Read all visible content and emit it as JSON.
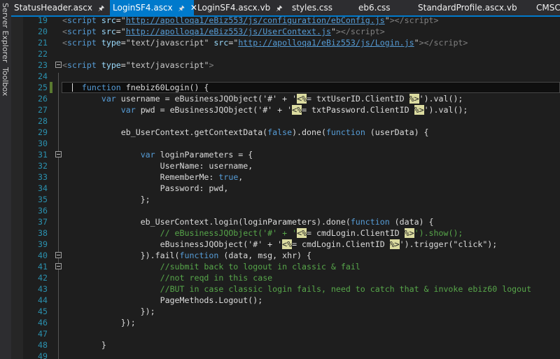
{
  "side_panels": [
    "Server Explorer",
    "Toolbox"
  ],
  "tabs": [
    {
      "label": "StatusHeader.ascx",
      "pinned": true,
      "active": false
    },
    {
      "label": "LoginSF4.ascx",
      "pinned": true,
      "active": true,
      "closable": true
    },
    {
      "label": "LoginSF4.ascx.vb",
      "pinned": true,
      "active": false
    },
    {
      "label": "styles.css",
      "active": false
    },
    {
      "label": "eb6.css",
      "active": false
    },
    {
      "label": "StandardProfile.ascx.vb",
      "active": false
    },
    {
      "label": "CMSC",
      "active": false
    }
  ],
  "icons": {
    "pin": "pin-icon",
    "close": "close-icon",
    "fold": "collapse-icon"
  },
  "editor": {
    "current_line": 25,
    "changed_lines": [
      25
    ],
    "fold_lines": [
      23,
      31,
      40,
      41
    ],
    "lines": [
      {
        "n": 19,
        "t": [
          [
            "<",
            "g"
          ],
          [
            "script",
            "k"
          ],
          [
            " src",
            "a"
          ],
          [
            "=",
            "p"
          ],
          [
            "\"",
            "s"
          ],
          [
            "http://apolloqa1/eBiz553/js/configuration/ebConfig.js",
            "u"
          ],
          [
            "\"",
            "s"
          ],
          [
            "></script>",
            "g"
          ]
        ]
      },
      {
        "n": 20,
        "t": [
          [
            "<",
            "g"
          ],
          [
            "script",
            "k"
          ],
          [
            " src",
            "a"
          ],
          [
            "=",
            "p"
          ],
          [
            "\"",
            "s"
          ],
          [
            "http://apolloqa1/eBiz553/js/UserContext.js",
            "u"
          ],
          [
            "\"",
            "s"
          ],
          [
            "></script>",
            "g"
          ]
        ]
      },
      {
        "n": 21,
        "t": [
          [
            "<",
            "g"
          ],
          [
            "script",
            "k"
          ],
          [
            " type",
            "a"
          ],
          [
            "=",
            "p"
          ],
          [
            "\"text/javascript\"",
            "s"
          ],
          [
            " src",
            "a"
          ],
          [
            "=",
            "p"
          ],
          [
            "\"",
            "s"
          ],
          [
            "http://apolloqa1/eBiz553/js/Login.js",
            "u"
          ],
          [
            "\"",
            "s"
          ],
          [
            "></script>",
            "g"
          ]
        ]
      },
      {
        "n": 22,
        "t": []
      },
      {
        "n": 23,
        "t": [
          [
            "<",
            "g"
          ],
          [
            "script",
            "k"
          ],
          [
            " type",
            "a"
          ],
          [
            "=",
            "p"
          ],
          [
            "\"text/javascript\"",
            "s"
          ],
          [
            ">",
            "g"
          ]
        ]
      },
      {
        "n": 24,
        "t": []
      },
      {
        "n": 25,
        "t": [
          [
            "    ",
            "p"
          ],
          [
            "function",
            "k"
          ],
          [
            " fnebiz60Login() {",
            "p"
          ]
        ]
      },
      {
        "n": 26,
        "t": [
          [
            "        ",
            "p"
          ],
          [
            "var",
            "k"
          ],
          [
            " username = eBusinessJQObject('#' + '",
            "p"
          ],
          [
            "<%",
            "d"
          ],
          [
            "= txtUserID.ClientID ",
            "p"
          ],
          [
            "%>",
            "d"
          ],
          [
            "').val();",
            "p"
          ]
        ]
      },
      {
        "n": 27,
        "t": [
          [
            "            ",
            "p"
          ],
          [
            "var",
            "k"
          ],
          [
            " pwd = eBusinessJQObject('#' + '",
            "p"
          ],
          [
            "<%",
            "d"
          ],
          [
            "= txtPassword.ClientID ",
            "p"
          ],
          [
            "%>",
            "d"
          ],
          [
            "').val();",
            "p"
          ]
        ]
      },
      {
        "n": 28,
        "t": []
      },
      {
        "n": 29,
        "t": [
          [
            "            eb_UserContext.getContextData(",
            "p"
          ],
          [
            "false",
            "k"
          ],
          [
            ").done(",
            "p"
          ],
          [
            "function",
            "k"
          ],
          [
            " (userData) {",
            "p"
          ]
        ]
      },
      {
        "n": 30,
        "t": []
      },
      {
        "n": 31,
        "t": [
          [
            "                ",
            "p"
          ],
          [
            "var",
            "k"
          ],
          [
            " loginParameters = {",
            "p"
          ]
        ]
      },
      {
        "n": 32,
        "t": [
          [
            "                    UserName: username,",
            "p"
          ]
        ]
      },
      {
        "n": 33,
        "t": [
          [
            "                    RememberMe: ",
            "p"
          ],
          [
            "true",
            "k"
          ],
          [
            ",",
            "p"
          ]
        ]
      },
      {
        "n": 34,
        "t": [
          [
            "                    Password: pwd,",
            "p"
          ]
        ]
      },
      {
        "n": 35,
        "t": [
          [
            "                };",
            "p"
          ]
        ]
      },
      {
        "n": 36,
        "t": []
      },
      {
        "n": 37,
        "t": [
          [
            "                eb_UserContext.login(loginParameters).done(",
            "p"
          ],
          [
            "function",
            "k"
          ],
          [
            " (data) {",
            "p"
          ]
        ]
      },
      {
        "n": 38,
        "t": [
          [
            "                    ",
            "p"
          ],
          [
            "// eBusinessJQObject('#' + '",
            "c"
          ],
          [
            "<%",
            "d"
          ],
          [
            "= cmdLogin.ClientID ",
            "p"
          ],
          [
            "%>",
            "d"
          ],
          [
            "').show();",
            "c"
          ]
        ]
      },
      {
        "n": 39,
        "t": [
          [
            "                    eBusinessJQObject('#' + '",
            "p"
          ],
          [
            "<%",
            "d"
          ],
          [
            "= cmdLogin.ClientID ",
            "p"
          ],
          [
            "%>",
            "d"
          ],
          [
            "').trigger(\"click\");",
            "p"
          ]
        ]
      },
      {
        "n": 40,
        "t": [
          [
            "                }).fail(",
            "p"
          ],
          [
            "function",
            "k"
          ],
          [
            " (data, msg, xhr) {",
            "p"
          ]
        ]
      },
      {
        "n": 41,
        "t": [
          [
            "                    ",
            "p"
          ],
          [
            "//submit back to logout in classic & fail",
            "c"
          ]
        ]
      },
      {
        "n": 42,
        "t": [
          [
            "                    ",
            "p"
          ],
          [
            "//not reqd in this case",
            "c"
          ]
        ]
      },
      {
        "n": 43,
        "t": [
          [
            "                    ",
            "p"
          ],
          [
            "//BUT in case classic login fails, need to catch that & invoke ebiz60 logout",
            "c"
          ]
        ]
      },
      {
        "n": 44,
        "t": [
          [
            "                    PageMethods.Logout();",
            "p"
          ]
        ]
      },
      {
        "n": 45,
        "t": [
          [
            "                });",
            "p"
          ]
        ]
      },
      {
        "n": 46,
        "t": [
          [
            "            });",
            "p"
          ]
        ]
      },
      {
        "n": 47,
        "t": []
      },
      {
        "n": 48,
        "t": [
          [
            "        }",
            "p"
          ]
        ]
      },
      {
        "n": 49,
        "t": []
      }
    ]
  }
}
